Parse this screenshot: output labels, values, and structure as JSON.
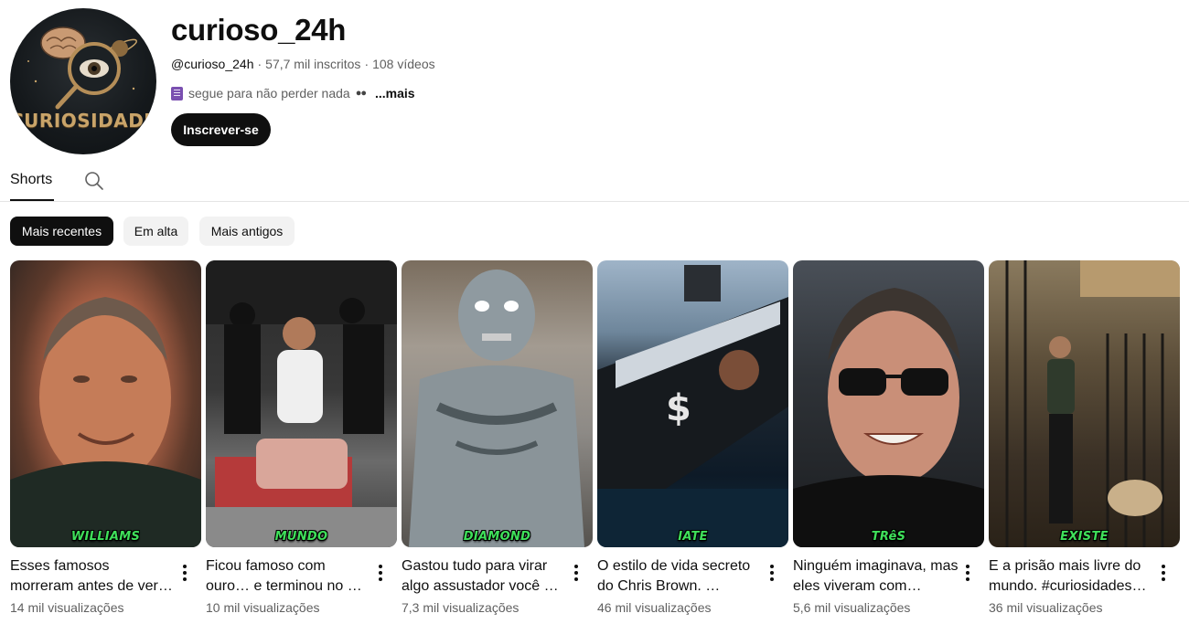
{
  "channel": {
    "avatar_text": "CURIOSIDADE",
    "name": "curioso_24h",
    "handle": "@curioso_24h",
    "subscribers": "57,7 mil inscritos",
    "videos": "108 vídeos",
    "description": "segue para não perder nada",
    "more_label": "...mais",
    "subscribe_label": "Inscrever-se"
  },
  "tabs": {
    "shorts_label": "Shorts"
  },
  "chips": [
    {
      "label": "Mais recentes",
      "active": true
    },
    {
      "label": "Em alta",
      "active": false
    },
    {
      "label": "Mais antigos",
      "active": false
    }
  ],
  "shorts": [
    {
      "label": "WILLIAMS",
      "title": "Esses famosos morreram antes de ver…",
      "views": "14 mil visualizações"
    },
    {
      "label": "MUNDO",
      "title": "Ficou famoso com ouro… e terminou no …",
      "views": "10 mil visualizações"
    },
    {
      "label": "DIAMOND",
      "title": "Gastou tudo para virar algo assustador você …",
      "views": "7,3 mil visualizações"
    },
    {
      "label": "IATE",
      "title": "O estilo de vida secreto do Chris Brown. …",
      "views": "46 mil visualizações"
    },
    {
      "label": "TRêS",
      "title": "Ninguém imaginava, mas eles viveram com…",
      "views": "5,6 mil visualizações"
    },
    {
      "label": "EXISTE",
      "title": "E a prisão mais livre do mundo. #curiosidades…",
      "views": "36 mil visualizações"
    }
  ],
  "colors": {
    "text_primary": "#0f0f0f",
    "text_secondary": "#606060",
    "chip_active": "#0f0f0f",
    "chip_idle": "#f2f2f2",
    "thumb_label": "#3fe05a",
    "avatar_text": "#c9a469"
  }
}
